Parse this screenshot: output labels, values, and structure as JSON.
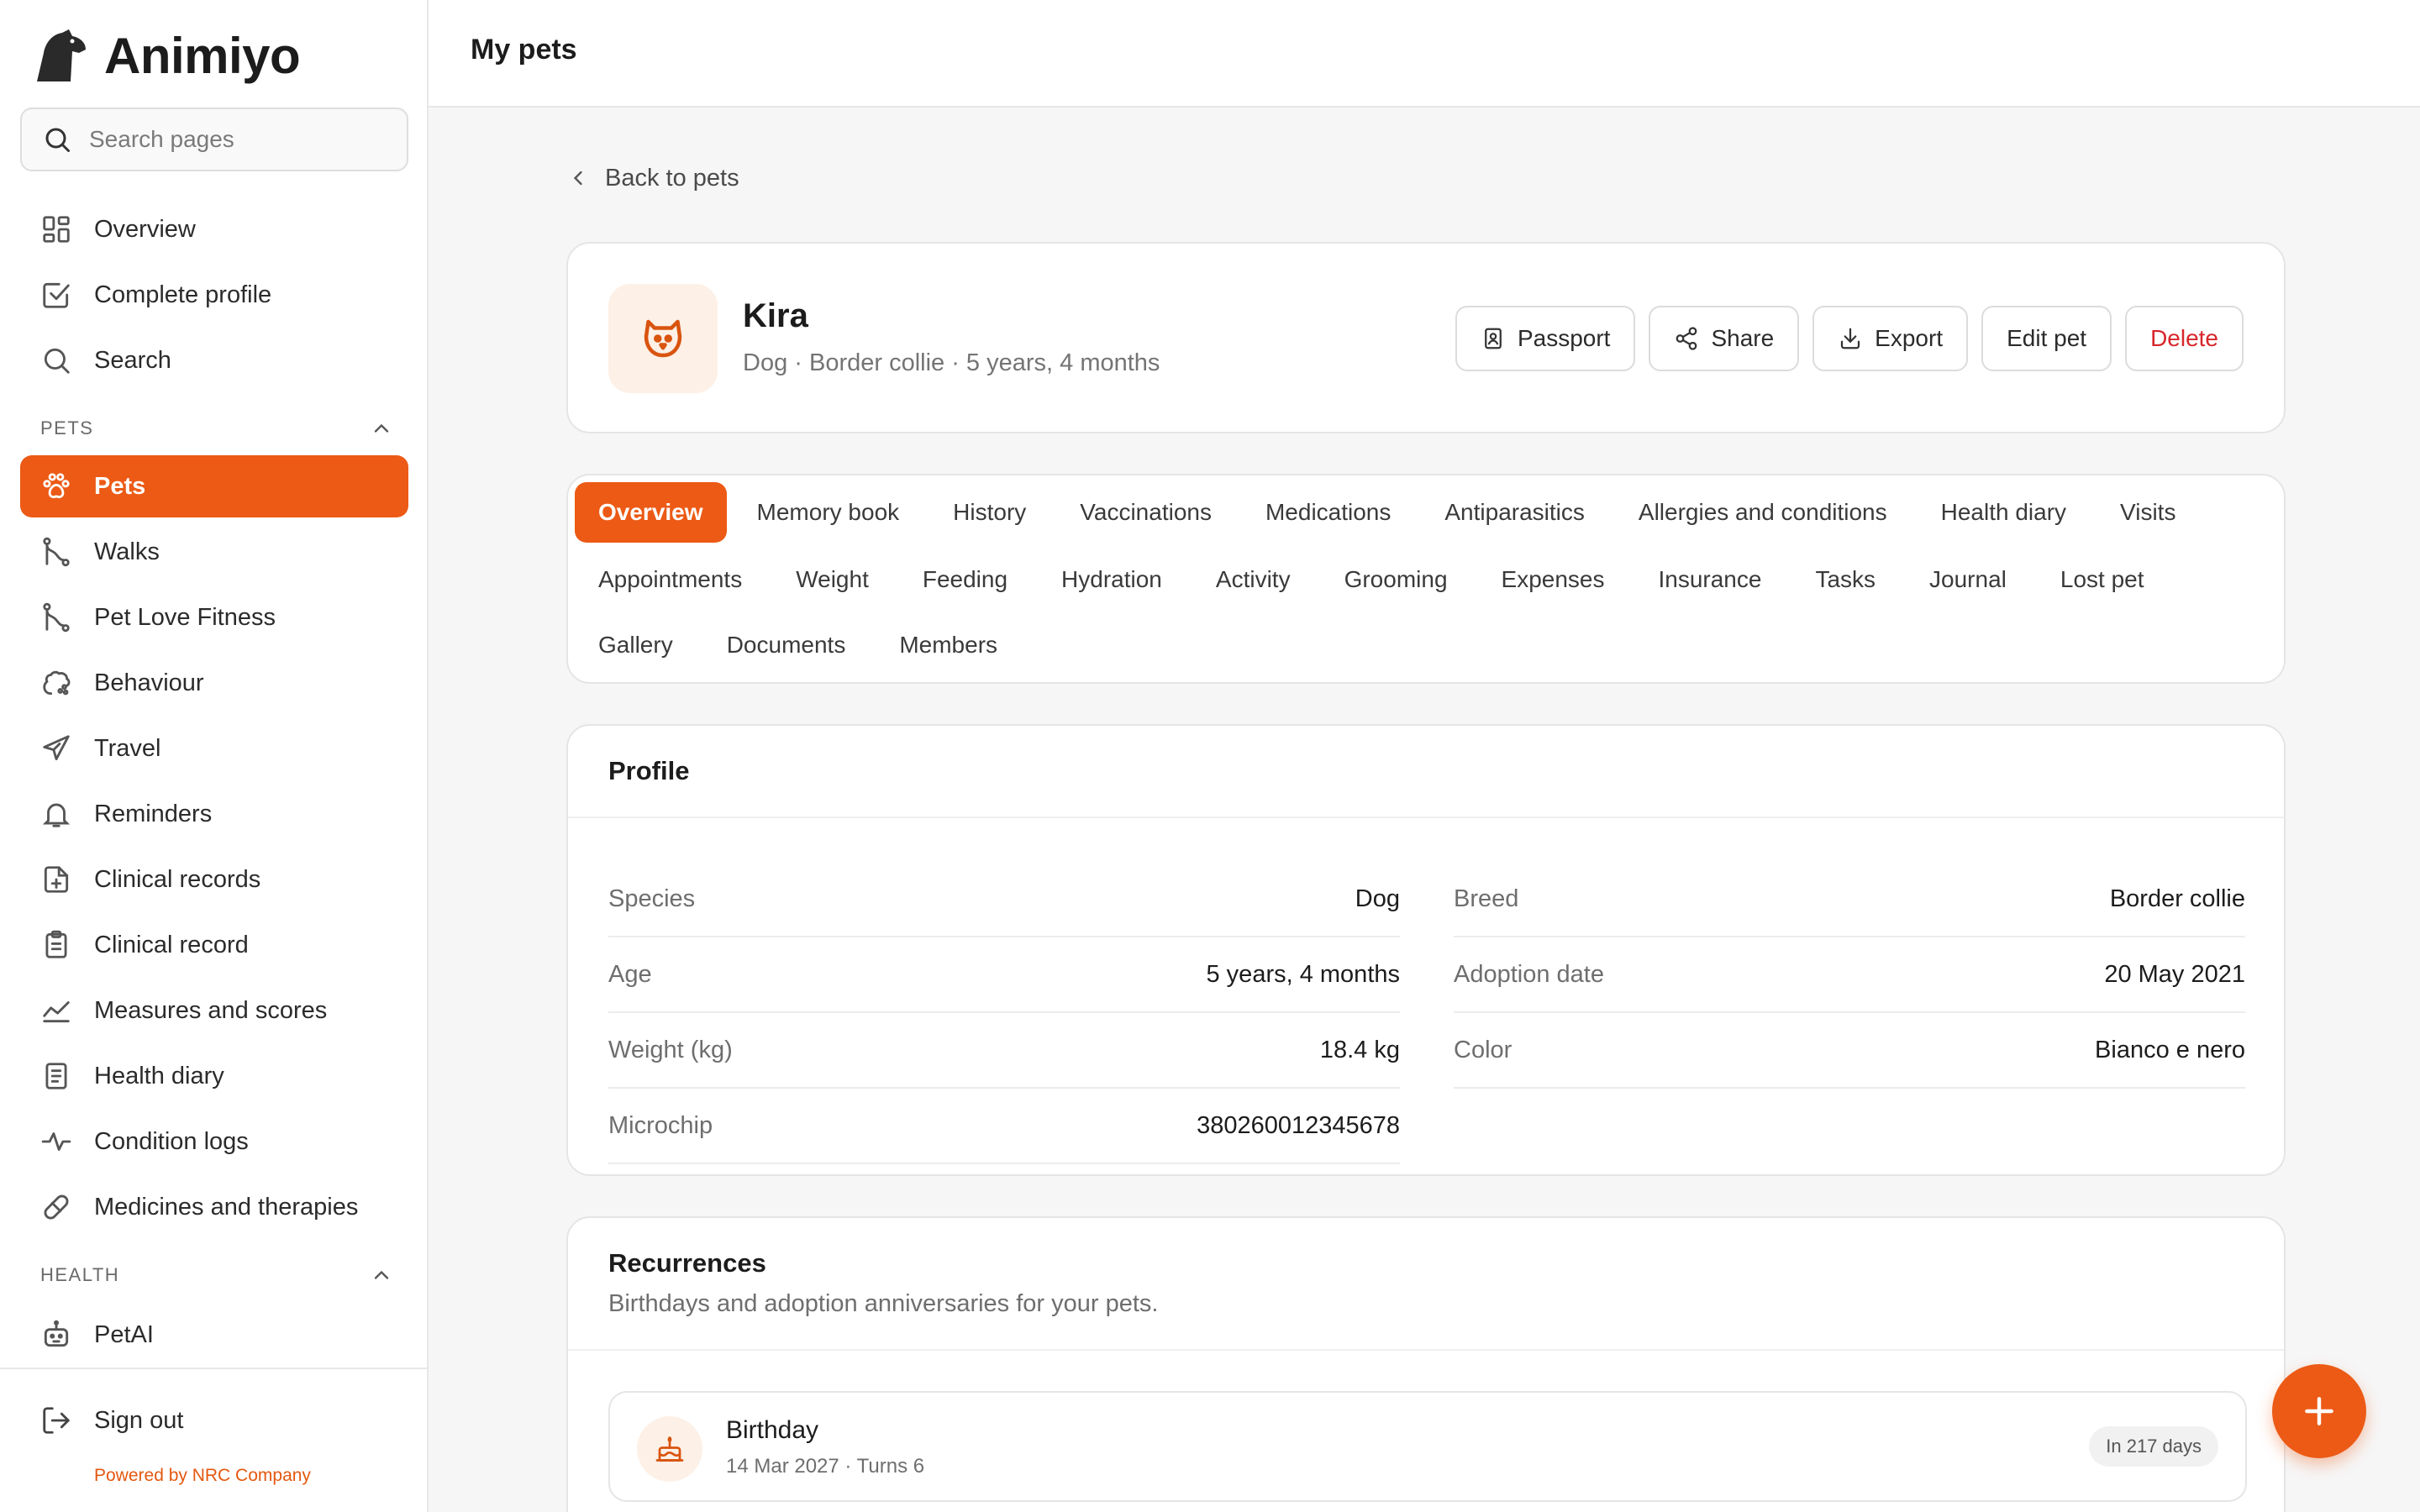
{
  "app": {
    "name": "Animiyo"
  },
  "colors": {
    "accent": "#ec5a15",
    "danger": "#d7262b",
    "avatar_bg": "#fdf0e6"
  },
  "sidebar": {
    "search_placeholder": "Search pages",
    "top_items": [
      {
        "label": "Overview",
        "icon": "grid-icon"
      },
      {
        "label": "Complete profile",
        "icon": "checkbox-icon"
      },
      {
        "label": "Search",
        "icon": "search-icon"
      }
    ],
    "pets_section": {
      "label": "PETS",
      "items": [
        {
          "label": "Pets",
          "icon": "paw-icon",
          "active": true
        },
        {
          "label": "Walks",
          "icon": "route-icon"
        },
        {
          "label": "Pet Love Fitness",
          "icon": "route-icon"
        },
        {
          "label": "Behaviour",
          "icon": "brain-icon"
        },
        {
          "label": "Travel",
          "icon": "plane-icon"
        },
        {
          "label": "Reminders",
          "icon": "bell-icon"
        },
        {
          "label": "Clinical records",
          "icon": "file-plus-icon"
        },
        {
          "label": "Clinical record",
          "icon": "clipboard-icon"
        },
        {
          "label": "Measures and scores",
          "icon": "chart-line-icon"
        },
        {
          "label": "Health diary",
          "icon": "notebook-icon"
        },
        {
          "label": "Condition logs",
          "icon": "pulse-icon"
        },
        {
          "label": "Medicines and therapies",
          "icon": "pill-icon"
        }
      ]
    },
    "health_section": {
      "label": "HEALTH",
      "items": [
        {
          "label": "PetAI",
          "icon": "robot-icon"
        }
      ]
    },
    "sign_out": "Sign out",
    "powered_by": "Powered by NRC Company"
  },
  "topbar": {
    "title": "My pets"
  },
  "back_link": "Back to pets",
  "pet": {
    "name": "Kira",
    "subtitle": "Dog · Border collie · 5 years, 4 months",
    "actions": {
      "passport": "Passport",
      "share": "Share",
      "export": "Export",
      "edit": "Edit pet",
      "delete": "Delete"
    }
  },
  "tabs": {
    "row1": [
      "Overview",
      "Memory book",
      "History",
      "Vaccinations",
      "Medications",
      "Antiparasitics",
      "Allergies and conditions",
      "Health diary",
      "Visits"
    ],
    "row2": [
      "Appointments",
      "Weight",
      "Feeding",
      "Hydration",
      "Activity",
      "Grooming",
      "Expenses",
      "Insurance",
      "Tasks",
      "Journal",
      "Lost pet"
    ],
    "row3": [
      "Gallery",
      "Documents",
      "Members"
    ],
    "active": "Overview"
  },
  "profile": {
    "title": "Profile",
    "left": [
      {
        "label": "Species",
        "value": "Dog"
      },
      {
        "label": "Age",
        "value": "5 years, 4 months"
      },
      {
        "label": "Weight (kg)",
        "value": "18.4 kg"
      },
      {
        "label": "Microchip",
        "value": "380260012345678"
      }
    ],
    "right": [
      {
        "label": "Breed",
        "value": "Border collie"
      },
      {
        "label": "Adoption date",
        "value": "20 May 2021"
      },
      {
        "label": "Color",
        "value": "Bianco e nero"
      }
    ]
  },
  "recurrences": {
    "title": "Recurrences",
    "subtitle": "Birthdays and adoption anniversaries for your pets.",
    "items": [
      {
        "title": "Birthday",
        "meta": "14 Mar 2027 · Turns 6",
        "badge": "In 217 days",
        "icon": "cake-icon"
      }
    ]
  },
  "fab": {
    "icon": "plus-icon"
  }
}
